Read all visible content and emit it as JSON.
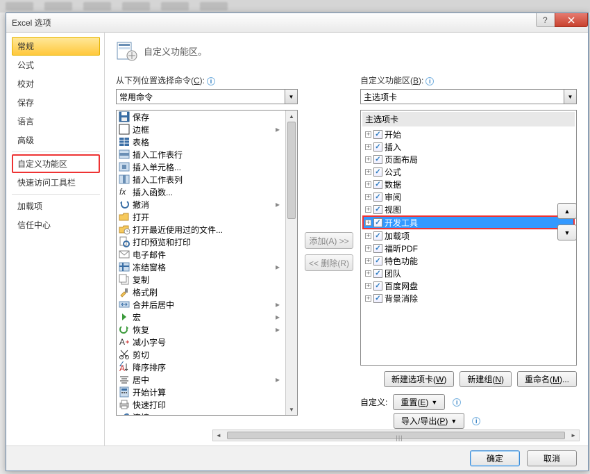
{
  "window": {
    "title": "Excel 选项"
  },
  "sidebar": {
    "items": [
      {
        "label": "常规",
        "active": true
      },
      {
        "label": "公式"
      },
      {
        "label": "校对"
      },
      {
        "label": "保存"
      },
      {
        "label": "语言"
      },
      {
        "label": "高级"
      },
      {
        "sep": true
      },
      {
        "label": "自定义功能区",
        "highlight": true
      },
      {
        "label": "快速访问工具栏"
      },
      {
        "sep": true
      },
      {
        "label": "加载项"
      },
      {
        "label": "信任中心"
      }
    ]
  },
  "header": {
    "title": "自定义功能区。"
  },
  "left": {
    "label_pre": "从下列位置选择命令(",
    "label_u": "C",
    "label_post": "):",
    "combo": "常用命令",
    "commands": [
      {
        "icon": "save",
        "label": "保存"
      },
      {
        "icon": "border",
        "label": "边框",
        "sub": true
      },
      {
        "icon": "table",
        "label": "表格"
      },
      {
        "icon": "sheetrow",
        "label": "插入工作表行"
      },
      {
        "icon": "cell",
        "label": "插入单元格..."
      },
      {
        "icon": "sheetcol",
        "label": "插入工作表列"
      },
      {
        "icon": "fx",
        "label": "插入函数..."
      },
      {
        "icon": "undo",
        "label": "撤消",
        "sub": true
      },
      {
        "icon": "open",
        "label": "打开"
      },
      {
        "icon": "recent",
        "label": "打开最近使用过的文件..."
      },
      {
        "icon": "preview",
        "label": "打印预览和打印"
      },
      {
        "icon": "email",
        "label": "电子邮件"
      },
      {
        "icon": "freeze",
        "label": "冻结窗格",
        "sub": true
      },
      {
        "icon": "copy",
        "label": "复制"
      },
      {
        "icon": "brush",
        "label": "格式刷"
      },
      {
        "icon": "merge",
        "label": "合并后居中",
        "sub": true
      },
      {
        "icon": "macro",
        "label": "宏",
        "sub": true
      },
      {
        "icon": "redo",
        "label": "恢复",
        "sub": true
      },
      {
        "icon": "fontdec",
        "label": "减小字号"
      },
      {
        "icon": "cut",
        "label": "剪切"
      },
      {
        "icon": "sortd",
        "label": "降序排序"
      },
      {
        "icon": "center",
        "label": "居中",
        "sub": true
      },
      {
        "icon": "calc",
        "label": "开始计算"
      },
      {
        "icon": "quickprint",
        "label": "快速打印"
      },
      {
        "icon": "link",
        "label": "连接"
      }
    ]
  },
  "mid": {
    "add_pre": "添加(",
    "add_u": "A",
    "add_post": ") >>",
    "remove_pre": "<< 删除(",
    "remove_u": "R",
    "remove_post": ")"
  },
  "right": {
    "label_pre": "自定义功能区(",
    "label_u": "B",
    "label_post": "):",
    "combo": "主选项卡",
    "tree_header": "主选项卡",
    "nodes": [
      {
        "label": "开始",
        "checked": true
      },
      {
        "label": "插入",
        "checked": true
      },
      {
        "label": "页面布局",
        "checked": true
      },
      {
        "label": "公式",
        "checked": true
      },
      {
        "label": "数据",
        "checked": true
      },
      {
        "label": "审阅",
        "checked": true
      },
      {
        "label": "视图",
        "checked": true
      },
      {
        "label": "开发工具",
        "checked": true,
        "selected": true
      },
      {
        "label": "加载项",
        "checked": true
      },
      {
        "label": "福昕PDF",
        "checked": true
      },
      {
        "label": "特色功能",
        "checked": true
      },
      {
        "label": "团队",
        "checked": true
      },
      {
        "label": "百度网盘",
        "checked": true
      },
      {
        "label": "背景消除",
        "checked": true
      }
    ],
    "buttons": {
      "newtab_pre": "新建选项卡(",
      "newtab_u": "W",
      "newtab_post": ")",
      "newgroup_pre": "新建组(",
      "newgroup_u": "N",
      "newgroup_post": ")",
      "rename_pre": "重命名(",
      "rename_u": "M",
      "rename_post": ")..."
    },
    "custom": {
      "label": "自定义:",
      "reset_pre": "重置(",
      "reset_u": "E",
      "reset_post": ")",
      "importexport_pre": "导入/导出(",
      "importexport_u": "P",
      "importexport_post": ")"
    }
  },
  "footer": {
    "ok": "确定",
    "cancel": "取消"
  },
  "glyphs": {
    "up": "▲",
    "down": "▼",
    "left": "◄",
    "right": "►",
    "dd": "▼",
    "sub": "▸",
    "plus": "+"
  }
}
